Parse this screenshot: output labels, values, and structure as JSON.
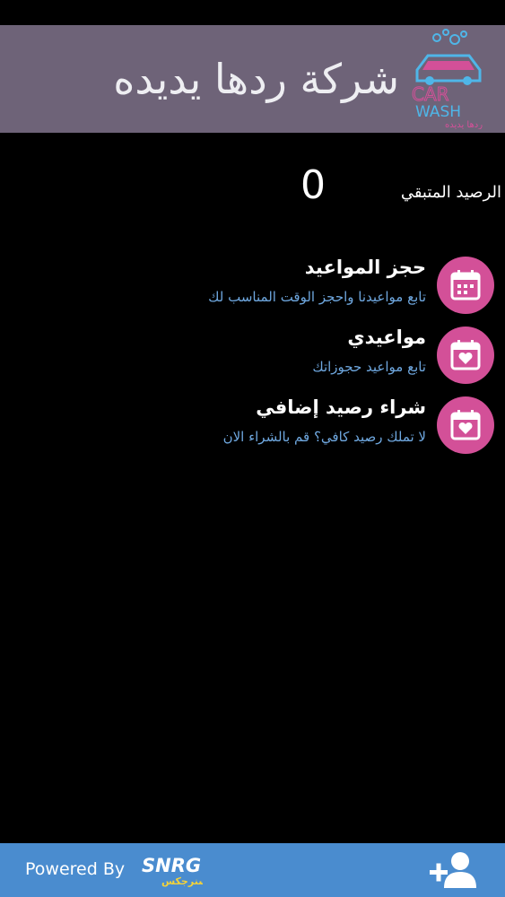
{
  "header": {
    "brand_title": "شركة ردها يديده",
    "logo": {
      "line1": "CAR",
      "line2": "WASH",
      "line3": "ردها يديده",
      "icon": "car-wash-logo-icon"
    }
  },
  "balance": {
    "label": "الرصيد المتبقي",
    "value": "0"
  },
  "menu": [
    {
      "title": "حجز المواعيد",
      "subtitle": "تابع مواعيدنا واحجز الوقت المناسب لك",
      "icon": "calendar-grid-icon"
    },
    {
      "title": "مواعيدي",
      "subtitle": "تابع مواعيد حجوزاتك",
      "icon": "calendar-heart-icon"
    },
    {
      "title": "شراء رصيد إضافي",
      "subtitle": "لا تملك رصيد كافي؟ قم بالشراء الان",
      "icon": "calendar-heart-icon"
    }
  ],
  "footer": {
    "powered_by": "Powered By",
    "brand_name": "SNRG",
    "brand_arabic": "سنرجكس",
    "add_user_icon": "add-user-icon"
  },
  "colors": {
    "header_bg": "#6e6378",
    "icon_bg": "#d35098",
    "subtitle": "#6fa8e0",
    "footer_bg": "#4a8ccf"
  }
}
